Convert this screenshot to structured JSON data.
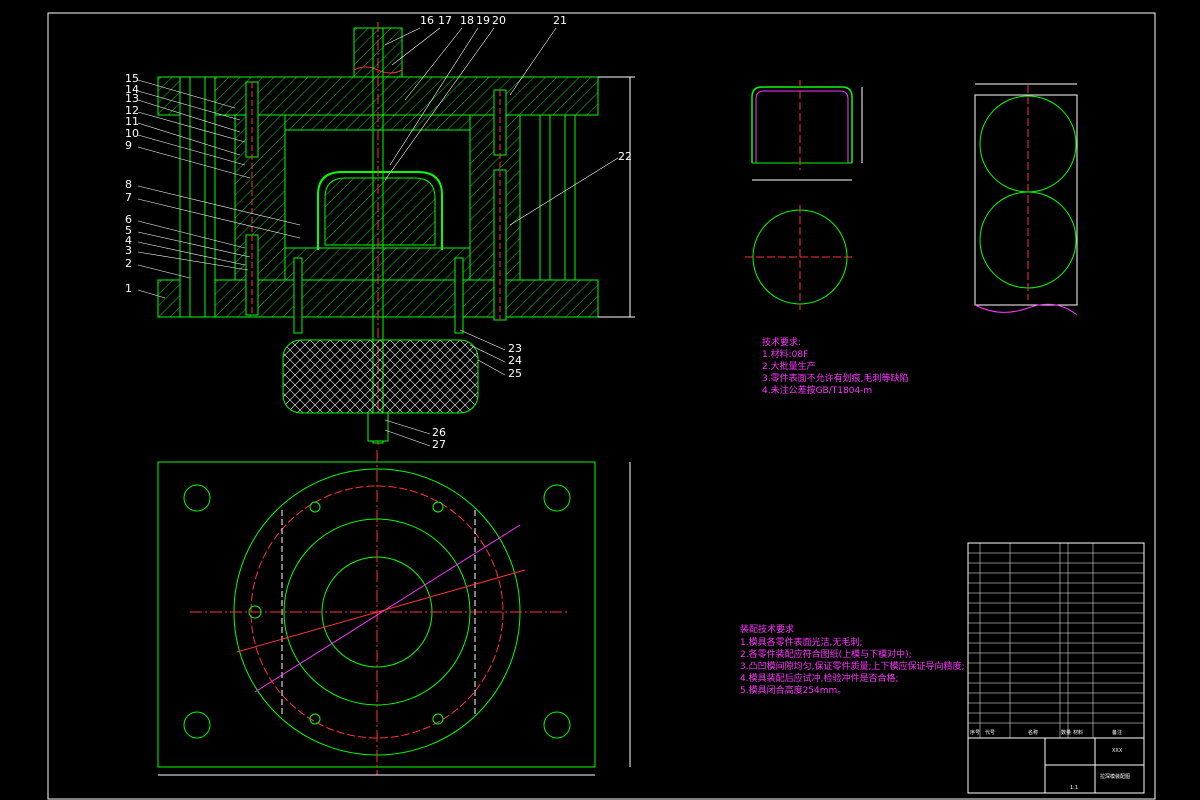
{
  "colors": {
    "background": "#000000",
    "outline": "#00ff00",
    "frame": "#ffffff",
    "leader": "#ffffff",
    "centerline": "#ff3333",
    "annotation": "#ff33ff",
    "dimension": "#ffffff"
  },
  "part_labels": {
    "left": [
      "15",
      "14",
      "13",
      "12",
      "11",
      "10",
      "9",
      "8",
      "7",
      "6",
      "5",
      "4",
      "3",
      "2",
      "1"
    ],
    "top": [
      "16",
      "17",
      "18",
      "19",
      "20",
      "21"
    ],
    "right_top": [
      "22"
    ],
    "bottom": [
      "23",
      "24",
      "25",
      "26",
      "27"
    ]
  },
  "notes": {
    "product_title": "技术要求:",
    "product_lines": [
      "1.材料:08F",
      "2.大批量生产",
      "3.零件表面不允许有划痕,毛刺等缺陷",
      "4.未注公差按GB/T1804-m"
    ],
    "die_title": "装配技术要求",
    "die_lines": [
      "1.模具各零件表面光洁,无毛刺;",
      "2.各零件装配应符合图纸(上模与下模对中);",
      "3.凸凹模间隙均匀,保证零件质量;上下模应保证导向精度;",
      "4.模具装配后应试冲,检验冲件是否合格;",
      "5.模具闭合高度254mm。"
    ]
  },
  "title_block": {
    "headers": [
      "序号",
      "代号",
      "名称",
      "数量",
      "材料",
      "备注"
    ],
    "title": "XXX",
    "drawing_name": "拉深模装配图",
    "scale": "1:1"
  }
}
